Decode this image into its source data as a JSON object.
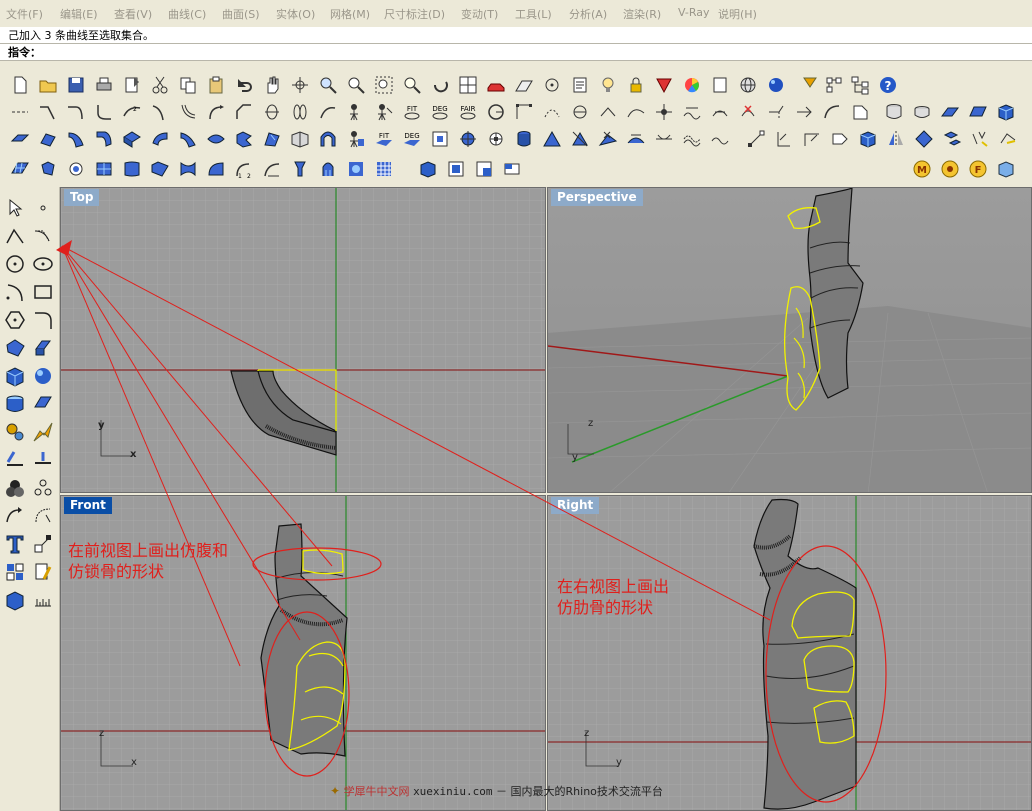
{
  "menu": [
    {
      "label": "文件(F)"
    },
    {
      "label": "编辑(E)"
    },
    {
      "label": "查看(V)"
    },
    {
      "label": "曲线(C)"
    },
    {
      "label": "曲面(S)"
    },
    {
      "label": "实体(O)"
    },
    {
      "label": "网格(M)"
    },
    {
      "label": "尺寸标注(D)"
    },
    {
      "label": "变动(T)"
    },
    {
      "label": "工具(L)"
    },
    {
      "label": "分析(A)"
    },
    {
      "label": "渲染(R)"
    },
    {
      "label": "V-Ray"
    },
    {
      "label": "说明(H)"
    }
  ],
  "command_history": "己加入 3 条曲线至选取集合。",
  "command_prompt": "指令：",
  "toolbar_text_buttons": {
    "fit1": "FIT",
    "deg1": "DEG",
    "fair": "FAIR",
    "fit2": "FIT",
    "deg2": "DEG",
    "fit3": "FIT",
    "deg3": "DEG"
  },
  "viewports": {
    "top": {
      "label": "Top"
    },
    "perspective": {
      "label": "Perspective"
    },
    "front": {
      "label": "Front"
    },
    "right": {
      "label": "Right"
    }
  },
  "axis_labels": {
    "x": "x",
    "y": "y",
    "z": "z"
  },
  "annotations": {
    "front_line1": "在前视图上画出仿腹和",
    "front_line2": "仿锁骨的形状",
    "right_line1": "在右视图上画出",
    "right_line2": "仿肋骨的形状"
  },
  "watermark": {
    "site": "学犀牛中文网",
    "url": "xuexiniu.com",
    "slogan": "－ 国内最大的Rhino技术交流平台"
  },
  "colors": {
    "active_label": "#0a4ea6",
    "inactive_label": "#8daac9",
    "annotation": "#e0201c",
    "viewport_bg": "#9c9c9c",
    "selected_curve": "#f2f200"
  }
}
